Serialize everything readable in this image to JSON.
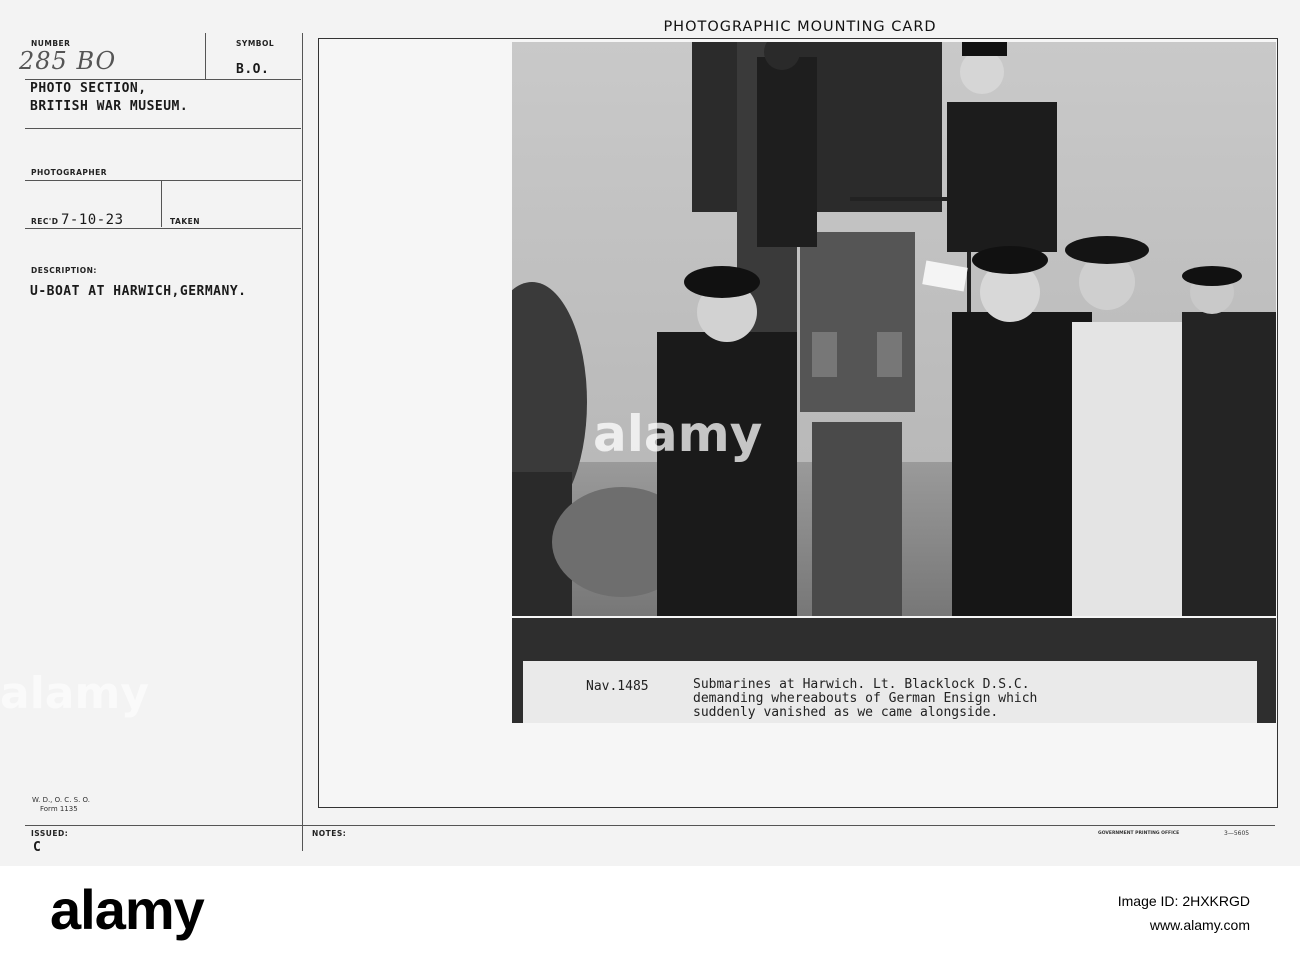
{
  "card": {
    "title": "PHOTOGRAPHIC MOUNTING CARD",
    "number_label": "NUMBER",
    "number_value": "285 BO",
    "symbol_label": "SYMBOL",
    "symbol_value": "B.O.",
    "org_line1": "PHOTO SECTION,",
    "org_line2": "BRITISH WAR MUSEUM.",
    "photographer_label": "PHOTOGRAPHER",
    "recd_label": "REC'D",
    "recd_value": "7-10-23",
    "taken_label": "TAKEN",
    "description_label": "DESCRIPTION:",
    "description_value": "U-BOAT AT HARWICH,GERMANY.",
    "form_line1": "W. D., O. C. S. O.",
    "form_line2": "Form 1135",
    "issued_label": "ISSUED:",
    "issued_value": "C",
    "notes_label": "NOTES:",
    "printing_office": "GOVERNMENT PRINTING OFFICE",
    "form_code": "3—5605"
  },
  "caption": {
    "number": "Nav.1485",
    "line1": "Submarines at Harwich. Lt. Blacklock D.S.C.",
    "line2": "demanding whereabouts of German Ensign which",
    "line3": "suddenly vanished as we came alongside."
  },
  "watermark": {
    "text": "alamy"
  },
  "footer": {
    "logo": "alamy",
    "image_id": "Image ID: 2HXKRGD",
    "site": "www.alamy.com"
  }
}
